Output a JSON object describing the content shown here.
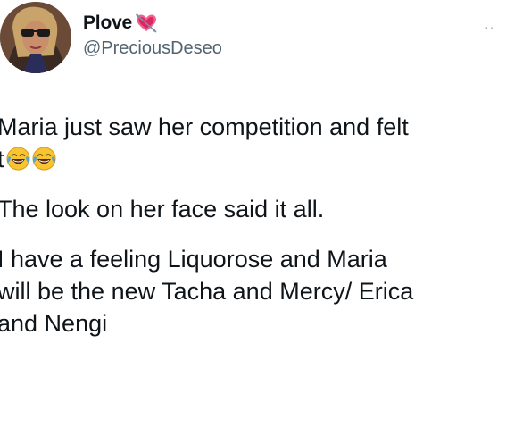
{
  "author": {
    "display_name": "Plove",
    "name_emoji_icon": "heart-with-arrow-icon",
    "handle": "@PreciousDeseo",
    "avatar_icon": "profile-photo-avatar"
  },
  "menu": {
    "icon": "more-options-icon",
    "glyph": "··"
  },
  "tweet": {
    "paragraph_1_line_1": "Maria just saw her competition and felt",
    "paragraph_1_line_2_prefix": "t",
    "paragraph_1_emojis": [
      "face-with-tears-of-joy-icon",
      "face-with-tears-of-joy-icon"
    ],
    "paragraph_2": "The look on her face said it all.",
    "paragraph_3_line_1": "I have a feeling Liquorose and Maria",
    "paragraph_3_line_2": "will be the new Tacha and Mercy/ Erica",
    "paragraph_3_line_3": "and Nengi"
  },
  "colors": {
    "text": "#0f1419",
    "secondary_text": "#536471",
    "heart": "#e0245e",
    "emoji_face": "#f7c531"
  }
}
